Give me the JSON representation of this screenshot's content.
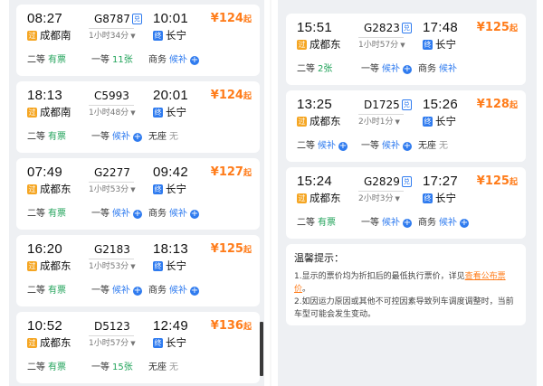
{
  "labels": {
    "price_suffix": "起",
    "fast_badge": "兑",
    "waitlist_plus": "+",
    "caret": "▼"
  },
  "left_trains": [
    {
      "dep_time": "08:27",
      "dep_station": "成都南",
      "dep_badge": "过",
      "train_no": "G8787",
      "has_dui": true,
      "duration": "1小时34分",
      "arr_time": "10:01",
      "arr_station": "长宁",
      "arr_badge": "终",
      "price": "¥124",
      "seats": [
        {
          "name": "二等",
          "val": "有票",
          "color": "green",
          "plus": false
        },
        {
          "name": "一等",
          "val": "11张",
          "color": "green",
          "plus": false
        },
        {
          "name": "商务",
          "val": "候补",
          "color": "blue",
          "plus": true
        }
      ]
    },
    {
      "dep_time": "18:13",
      "dep_station": "成都南",
      "dep_badge": "过",
      "train_no": "C5993",
      "has_dui": false,
      "duration": "1小时48分",
      "arr_time": "20:01",
      "arr_station": "长宁",
      "arr_badge": "终",
      "price": "¥124",
      "seats": [
        {
          "name": "二等",
          "val": "有票",
          "color": "green",
          "plus": false
        },
        {
          "name": "一等",
          "val": "候补",
          "color": "blue",
          "plus": true
        },
        {
          "name": "无座",
          "val": "无",
          "color": "gray",
          "plus": false
        }
      ]
    },
    {
      "dep_time": "07:49",
      "dep_station": "成都东",
      "dep_badge": "过",
      "train_no": "G2277",
      "has_dui": false,
      "duration": "1小时53分",
      "arr_time": "09:42",
      "arr_station": "长宁",
      "arr_badge": "终",
      "price": "¥127",
      "seats": [
        {
          "name": "二等",
          "val": "有票",
          "color": "green",
          "plus": false
        },
        {
          "name": "一等",
          "val": "候补",
          "color": "blue",
          "plus": true
        },
        {
          "name": "商务",
          "val": "候补",
          "color": "blue",
          "plus": true
        }
      ]
    },
    {
      "dep_time": "16:20",
      "dep_station": "成都东",
      "dep_badge": "过",
      "train_no": "G2183",
      "has_dui": false,
      "duration": "1小时53分",
      "arr_time": "18:13",
      "arr_station": "长宁",
      "arr_badge": "终",
      "price": "¥125",
      "seats": [
        {
          "name": "二等",
          "val": "有票",
          "color": "green",
          "plus": false
        },
        {
          "name": "一等",
          "val": "候补",
          "color": "blue",
          "plus": true
        },
        {
          "name": "商务",
          "val": "候补",
          "color": "blue",
          "plus": true
        }
      ]
    },
    {
      "dep_time": "10:52",
      "dep_station": "成都东",
      "dep_badge": "过",
      "train_no": "D5123",
      "has_dui": false,
      "duration": "1小时57分",
      "arr_time": "12:49",
      "arr_station": "长宁",
      "arr_badge": "终",
      "price": "¥136",
      "seats": [
        {
          "name": "二等",
          "val": "有票",
          "color": "green",
          "plus": false
        },
        {
          "name": "一等",
          "val": "15张",
          "color": "green",
          "plus": false
        },
        {
          "name": "无座",
          "val": "无",
          "color": "gray",
          "plus": false
        }
      ]
    }
  ],
  "right_trains": [
    {
      "dep_time": "15:51",
      "dep_station": "成都东",
      "dep_badge": "过",
      "train_no": "G2823",
      "has_dui": true,
      "duration": "1小时57分",
      "arr_time": "17:48",
      "arr_station": "长宁",
      "arr_badge": "终",
      "price": "¥125",
      "seats": [
        {
          "name": "二等",
          "val": "2张",
          "color": "green",
          "plus": false
        },
        {
          "name": "一等",
          "val": "候补",
          "color": "blue",
          "plus": true
        },
        {
          "name": "商务",
          "val": "候补",
          "color": "blue",
          "plus": false
        }
      ]
    },
    {
      "dep_time": "13:25",
      "dep_station": "成都东",
      "dep_badge": "过",
      "train_no": "D1725",
      "has_dui": true,
      "duration": "2小时1分",
      "arr_time": "15:26",
      "arr_station": "长宁",
      "arr_badge": "终",
      "price": "¥128",
      "seats": [
        {
          "name": "二等",
          "val": "候补",
          "color": "blue",
          "plus": true
        },
        {
          "name": "一等",
          "val": "候补",
          "color": "blue",
          "plus": true
        },
        {
          "name": "无座",
          "val": "无",
          "color": "gray",
          "plus": false
        }
      ]
    },
    {
      "dep_time": "15:24",
      "dep_station": "成都东",
      "dep_badge": "过",
      "train_no": "G2829",
      "has_dui": true,
      "duration": "2小时3分",
      "arr_time": "17:27",
      "arr_station": "长宁",
      "arr_badge": "终",
      "price": "¥125",
      "seats": [
        {
          "name": "二等",
          "val": "有票",
          "color": "green",
          "plus": false
        },
        {
          "name": "一等",
          "val": "候补",
          "color": "blue",
          "plus": true
        },
        {
          "name": "商务",
          "val": "候补",
          "color": "blue",
          "plus": true
        }
      ]
    }
  ],
  "tips": {
    "title": "温馨提示：",
    "line1_text": "1.显示的票价均为折扣后的最低执行票价，详见",
    "line1_link": "查看公布票价",
    "line1_end": "。",
    "line2": "2.如因运力原因或其他不可控因素导致列车调度调整时，当前车型可能会发生变动。"
  },
  "colors": {
    "price": "#ff7c1a",
    "available": "#21a35a",
    "waitlist": "#2f7bef",
    "none": "#9a9a9a"
  }
}
